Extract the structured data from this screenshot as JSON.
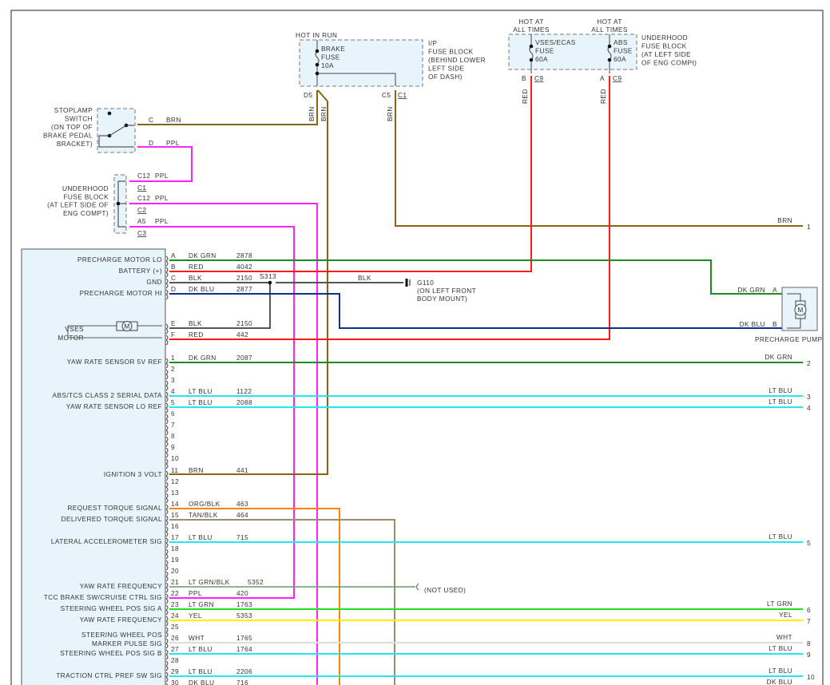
{
  "stoplamp_switch": {
    "label": [
      "STOPLAMP",
      "SWITCH",
      "(ON TOP OF",
      "BRAKE PEDAL",
      "BRACKET)"
    ],
    "pins": [
      {
        "pin": "C",
        "wire": "BRN"
      },
      {
        "pin": "D",
        "wire": "PPL"
      }
    ]
  },
  "underhood_fuse_block_left": {
    "label": [
      "UNDERHOOD",
      "FUSE BLOCK",
      "(AT LEFT SIDE OF",
      "ENG COMPT)"
    ],
    "pins": [
      {
        "pin": "C12",
        "wire": "PPL",
        "connector": "C1"
      },
      {
        "pin": "C12",
        "wire": "PPL",
        "connector": "C2"
      },
      {
        "pin": "A5",
        "wire": "PPL",
        "connector": "C3"
      }
    ]
  },
  "ip_fuse_block": {
    "hot": "HOT IN RUN",
    "fuse": [
      "BRAKE",
      "FUSE",
      "10A"
    ],
    "label": [
      "I/P",
      "FUSE BLOCK",
      "(BEHIND LOWER",
      "LEFT SIDE",
      "OF DASH)"
    ],
    "pin_d5": "D5",
    "pin_c5": "C5",
    "connector": "C1",
    "wires": [
      "BRN",
      "BRN",
      "BRN"
    ]
  },
  "underhood_fuse_block_top": {
    "label": [
      "UNDERHOOD",
      "FUSE BLOCK",
      "(AT LEFT SIDE",
      "OF ENG COMPt)"
    ],
    "fuses": [
      {
        "hot": [
          "HOT AT",
          "ALL TIMES"
        ],
        "name": [
          "VSES/ECAS",
          "FUSE",
          "60A"
        ],
        "pin": "B",
        "connector": "C9",
        "wire": "RED"
      },
      {
        "hot": [
          "HOT AT",
          "ALL TIMES"
        ],
        "name": [
          "ABS",
          "FUSE",
          "60A"
        ],
        "pin": "A",
        "connector": "C9",
        "wire": "RED"
      }
    ]
  },
  "splice": "S313",
  "ground": {
    "id": "G110",
    "label": [
      "(ON LEFT FRONT",
      "BODY MOUNT)"
    ],
    "wire": "BLK"
  },
  "precharge_pump": {
    "label": "PRECHARGE PUMP",
    "motor": "M",
    "pins": [
      {
        "pin": "A",
        "wire": "DK GRN"
      },
      {
        "pin": "B",
        "wire": "DK BLU"
      }
    ]
  },
  "module": {
    "vses_motor": [
      "VSES",
      "MOTOR"
    ],
    "motor": "M",
    "pins": [
      {
        "pin": "A",
        "func": [
          "PRECHARGE MOTOR LO"
        ],
        "wire": "DK GRN",
        "circuit": "2878",
        "hex": "#1e8c1e"
      },
      {
        "pin": "B",
        "func": [
          "BATTERY (+)"
        ],
        "wire": "RED",
        "circuit": "4042",
        "hex": "#ff1a1a"
      },
      {
        "pin": "C",
        "func": [
          "GND"
        ],
        "wire": "BLK",
        "circuit": "2150",
        "hex": "#555555"
      },
      {
        "pin": "D",
        "func": [
          "PRECHARGE MOTOR HI"
        ],
        "wire": "DK BLU",
        "circuit": "2877",
        "hex": "#10308c"
      },
      {
        "pin": "E",
        "func": [],
        "wire": "BLK",
        "circuit": "2150",
        "hex": "#555555"
      },
      {
        "pin": "F",
        "func": [],
        "wire": "RED",
        "circuit": "442",
        "hex": "#ff1a1a"
      },
      {
        "pin": "1",
        "func": [
          "YAW RATE SENSOR 5V REF"
        ],
        "wire": "DK GRN",
        "circuit": "2087",
        "hex": "#1e8c1e"
      },
      {
        "pin": "2",
        "func": [],
        "wire": "",
        "circuit": ""
      },
      {
        "pin": "3",
        "func": [],
        "wire": "",
        "circuit": ""
      },
      {
        "pin": "4",
        "func": [
          "ABS/TCS CLASS 2 SERIAL DATA"
        ],
        "wire": "LT BLU",
        "circuit": "1122",
        "hex": "#22e6f2"
      },
      {
        "pin": "5",
        "func": [
          "YAW RATE SENSOR LO REF"
        ],
        "wire": "LT BLU",
        "circuit": "2088",
        "hex": "#22e6f2"
      },
      {
        "pin": "6",
        "func": [],
        "wire": "",
        "circuit": ""
      },
      {
        "pin": "7",
        "func": [],
        "wire": "",
        "circuit": ""
      },
      {
        "pin": "8",
        "func": [],
        "wire": "",
        "circuit": ""
      },
      {
        "pin": "9",
        "func": [],
        "wire": "",
        "circuit": ""
      },
      {
        "pin": "10",
        "func": [],
        "wire": "",
        "circuit": ""
      },
      {
        "pin": "11",
        "func": [
          "IGNITION 3 VOLT"
        ],
        "wire": "BRN",
        "circuit": "441",
        "hex": "#8a6414"
      },
      {
        "pin": "12",
        "func": [],
        "wire": "",
        "circuit": ""
      },
      {
        "pin": "13",
        "func": [],
        "wire": "",
        "circuit": ""
      },
      {
        "pin": "14",
        "func": [
          "REQUEST TORQUE SIGNAL"
        ],
        "wire": "ORG/BLK",
        "circuit": "463",
        "hex": "#ff8400"
      },
      {
        "pin": "15",
        "func": [
          "DELIVERED TORQUE SIGNAL"
        ],
        "wire": "TAN/BLK",
        "circuit": "464",
        "hex": "#9a8c6c"
      },
      {
        "pin": "16",
        "func": [],
        "wire": "",
        "circuit": ""
      },
      {
        "pin": "17",
        "func": [
          "LATERAL ACCELEROMETER SIG"
        ],
        "wire": "LT BLU",
        "circuit": "715",
        "hex": "#22e6f2"
      },
      {
        "pin": "18",
        "func": [],
        "wire": "",
        "circuit": ""
      },
      {
        "pin": "19",
        "func": [],
        "wire": "",
        "circuit": ""
      },
      {
        "pin": "20",
        "func": [],
        "wire": "",
        "circuit": ""
      },
      {
        "pin": "21",
        "func": [
          "YAW RATE FREQUENCY"
        ],
        "wire": "LT GRN/BLK",
        "circuit": "5352",
        "hex": "#6a9a6a"
      },
      {
        "pin": "22",
        "func": [
          "TCC BRAKE SW/CRUISE CTRL SIG"
        ],
        "wire": "PPL",
        "circuit": "420",
        "hex": "#ff22ff"
      },
      {
        "pin": "23",
        "func": [
          "STEERING WHEEL POS SIG A"
        ],
        "wire": "LT GRN",
        "circuit": "1763",
        "hex": "#22dd22"
      },
      {
        "pin": "24",
        "func": [
          "YAW RATE FREQUENCY"
        ],
        "wire": "YEL",
        "circuit": "5353",
        "hex": "#ffee00"
      },
      {
        "pin": "25",
        "func": [],
        "wire": "",
        "circuit": ""
      },
      {
        "pin": "26",
        "func": [
          "STEERING WHEEL POS",
          "MARKER PULSE SIG"
        ],
        "wire": "WHT",
        "circuit": "1765",
        "hex": "#dddddd"
      },
      {
        "pin": "27",
        "func": [
          "STEERING WHEEL POS SIG B"
        ],
        "wire": "LT BLU",
        "circuit": "1764",
        "hex": "#22e6f2"
      },
      {
        "pin": "28",
        "func": [],
        "wire": "",
        "circuit": ""
      },
      {
        "pin": "29",
        "func": [
          "TRACTION CTRL PREF SW SIG"
        ],
        "wire": "LT BLU",
        "circuit": "2206",
        "hex": "#22e6f2"
      },
      {
        "pin": "30",
        "func": [],
        "wire": "DK BLU",
        "circuit": "716",
        "hex": "#10308c"
      }
    ]
  },
  "harness": [
    {
      "num": "1",
      "wire": "BRN"
    },
    {
      "num": "2",
      "wire": "DK GRN"
    },
    {
      "num": "3",
      "wire": "LT BLU"
    },
    {
      "num": "4",
      "wire": "LT BLU"
    },
    {
      "num": "5",
      "wire": "LT BLU"
    },
    {
      "num": "6",
      "wire": "LT GRN"
    },
    {
      "num": "7",
      "wire": "YEL"
    },
    {
      "num": "8",
      "wire": "WHT"
    },
    {
      "num": "9",
      "wire": "LT BLU"
    },
    {
      "num": "10",
      "wire": "LT BLU"
    },
    {
      "num": "",
      "wire": "DK BLU"
    }
  ],
  "not_used": "(NOT USED)",
  "colors": {
    "brn": "#8a6414",
    "ppl": "#ff22ff",
    "red": "#ff1a1a",
    "blk": "#555555",
    "box_fill": "#e8f4fb"
  }
}
